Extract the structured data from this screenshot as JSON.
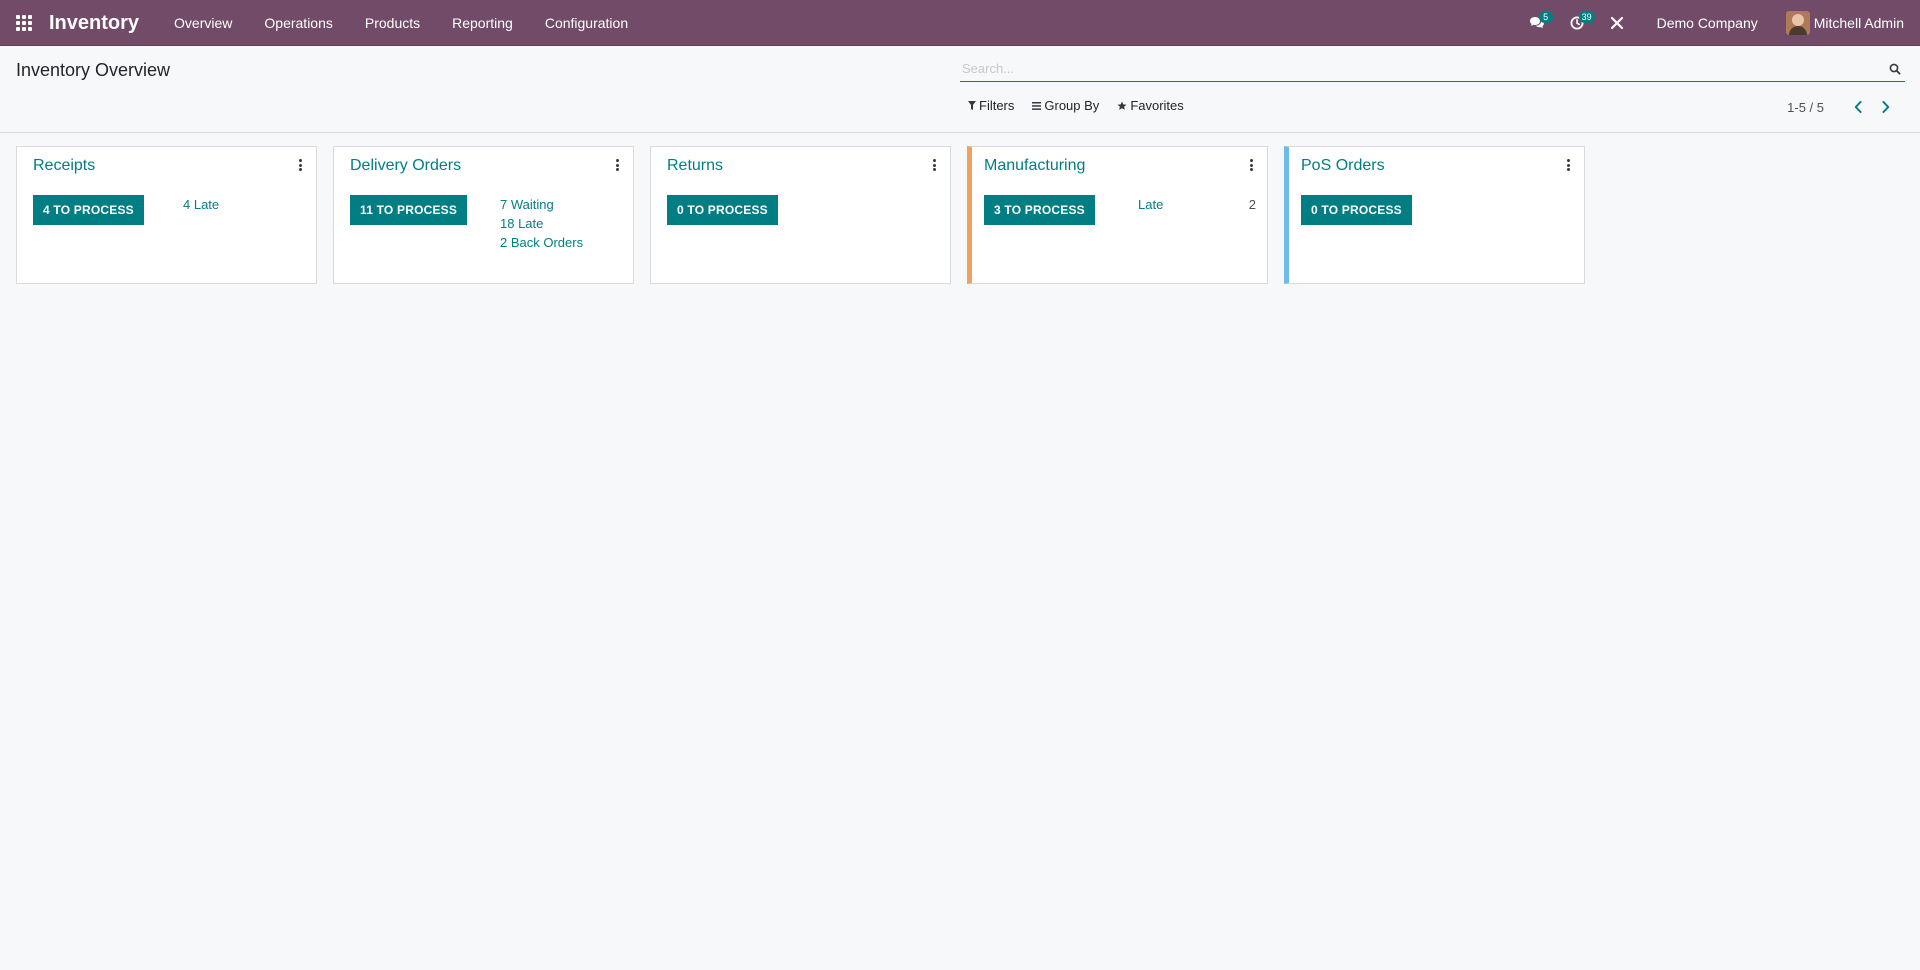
{
  "navbar": {
    "brand": "Inventory",
    "menu": [
      "Overview",
      "Operations",
      "Products",
      "Reporting",
      "Configuration"
    ],
    "messages_badge": "5",
    "activities_badge": "39",
    "company": "Demo Company",
    "user": "Mitchell Admin"
  },
  "control_panel": {
    "title": "Inventory Overview",
    "search_placeholder": "Search...",
    "filters_label": "Filters",
    "group_by_label": "Group By",
    "favorites_label": "Favorites",
    "pager": "1-5 / 5"
  },
  "cards": [
    {
      "title": "Receipts",
      "button": "4 TO PROCESS",
      "stats": [
        "4 Late"
      ]
    },
    {
      "title": "Delivery Orders",
      "button": "11 TO PROCESS",
      "stats": [
        "7 Waiting",
        "18 Late",
        "2 Back Orders"
      ]
    },
    {
      "title": "Returns",
      "button": "0 TO PROCESS",
      "stats": []
    },
    {
      "title": "Manufacturing",
      "button": "3 TO PROCESS",
      "stat_label": "Late",
      "stat_value": "2",
      "accent": "#f0a15a"
    },
    {
      "title": "PoS Orders",
      "button": "0 TO PROCESS",
      "stats": [],
      "accent": "#6cbbe8"
    }
  ],
  "colors": {
    "navbar": "#714b67",
    "primary": "#017e84"
  }
}
